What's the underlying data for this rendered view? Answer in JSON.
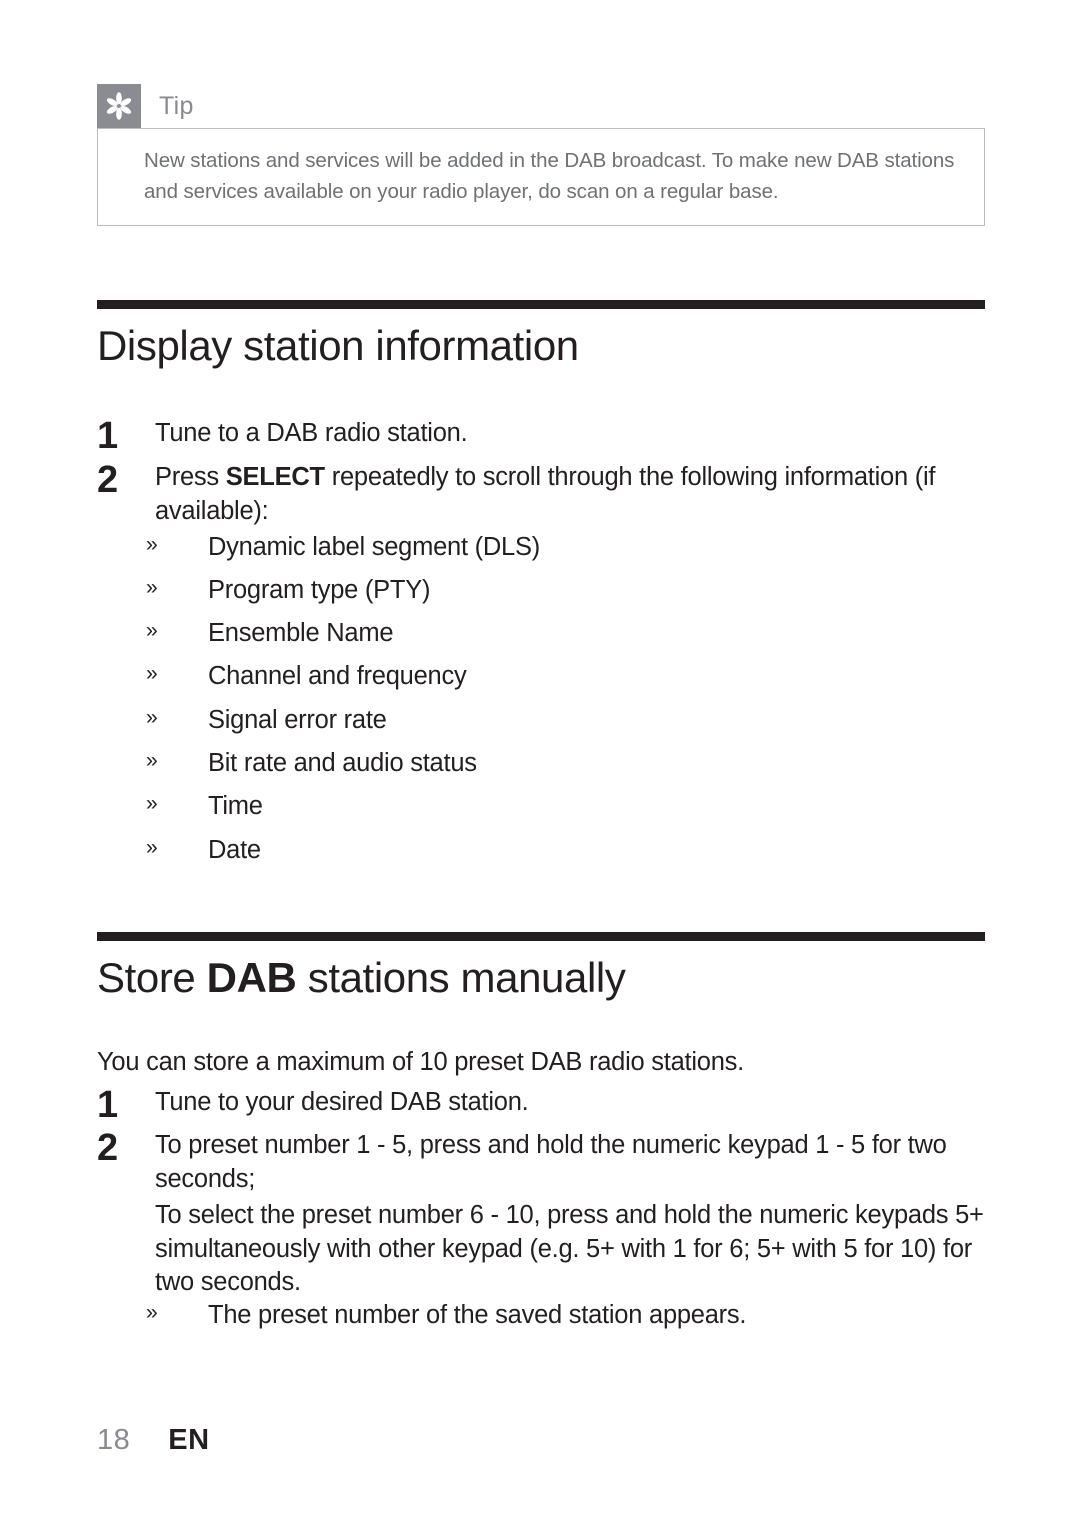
{
  "tip": {
    "icon": "asterisk-flower-icon",
    "label": "Tip",
    "text": "New stations and services will be added in the DAB broadcast. To make new DAB stations and services available on your radio player, do scan on a regular base.",
    "icon_bg": "#8b8b92",
    "label_color": "#8a8a92",
    "border_color": "#b9bcc6",
    "text_color": "#6f7176"
  },
  "sections": [
    {
      "title_plain": "Display station information",
      "rule_color": "#231f20",
      "steps": [
        {
          "number": "1",
          "text_before": "Tune to a DAB radio station.",
          "bold": "",
          "text_after": ""
        },
        {
          "number": "2",
          "text_before": "Press ",
          "bold": "SELECT",
          "text_after": " repeatedly to scroll through the following information (if available):"
        }
      ],
      "bullets": [
        {
          "mark": "»",
          "text": "Dynamic label segment (DLS)"
        },
        {
          "mark": "»",
          "text": "Program type (PTY)"
        },
        {
          "mark": "»",
          "text": "Ensemble Name"
        },
        {
          "mark": "»",
          "text": "Channel and frequency"
        },
        {
          "mark": "»",
          "text": "Signal error rate"
        },
        {
          "mark": "»",
          "text": "Bit rate and audio status"
        },
        {
          "mark": "»",
          "text": "Time"
        },
        {
          "mark": "»",
          "text": "Date"
        }
      ]
    },
    {
      "title_part1": "Store ",
      "title_bold": "DAB",
      "title_part2": " stations manually",
      "intro": "You can store a maximum of 10 preset DAB radio stations.",
      "steps": [
        {
          "number": "1",
          "text": "Tune to your desired DAB station."
        },
        {
          "number": "2",
          "text": "To preset number 1 - 5, press and hold the numeric keypad 1 - 5 for two seconds;"
        }
      ],
      "continuation": "To select the preset number 6 - 10, press and hold the numeric keypads 5+ simultaneously with other keypad (e.g. 5+ with 1 for 6; 5+ with 5 for 10) for two seconds.",
      "bullets": [
        {
          "mark": "»",
          "text": "The preset number of the saved station appears."
        }
      ]
    }
  ],
  "footer": {
    "page_number": "18",
    "language": "EN"
  }
}
